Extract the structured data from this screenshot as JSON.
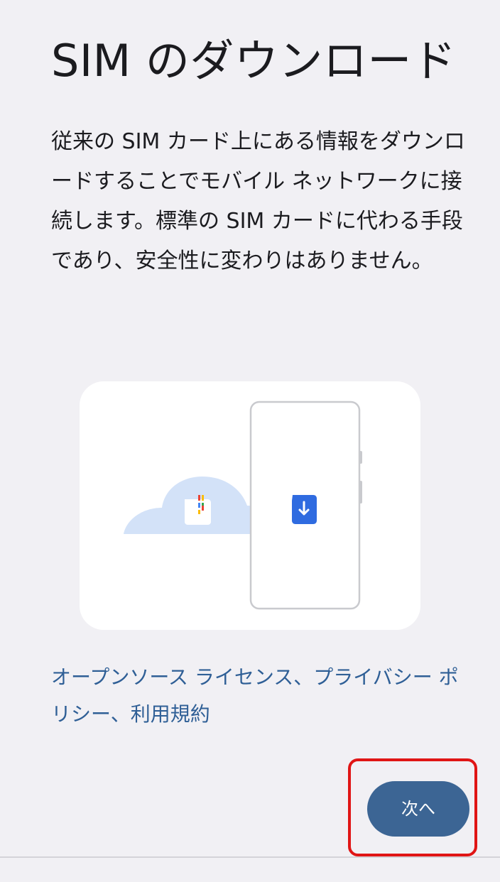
{
  "header": {
    "title": "SIM のダウンロード"
  },
  "main": {
    "description": "従来の SIM カード上にある情報をダウンロードすることでモバイル ネットワークに接続します。標準の SIM カードに代わる手段であり、安全性に変わりはありません。",
    "links": {
      "open_source": "オープンソース ライセンス",
      "separator1": "、",
      "privacy": "プライバシー ポリシー",
      "separator2": "、",
      "terms": "利用規約"
    }
  },
  "footer": {
    "next_label": "次へ"
  },
  "colors": {
    "background": "#f1f0f4",
    "accent": "#3c6594",
    "link": "#2f5f96",
    "highlight": "#e01515"
  }
}
